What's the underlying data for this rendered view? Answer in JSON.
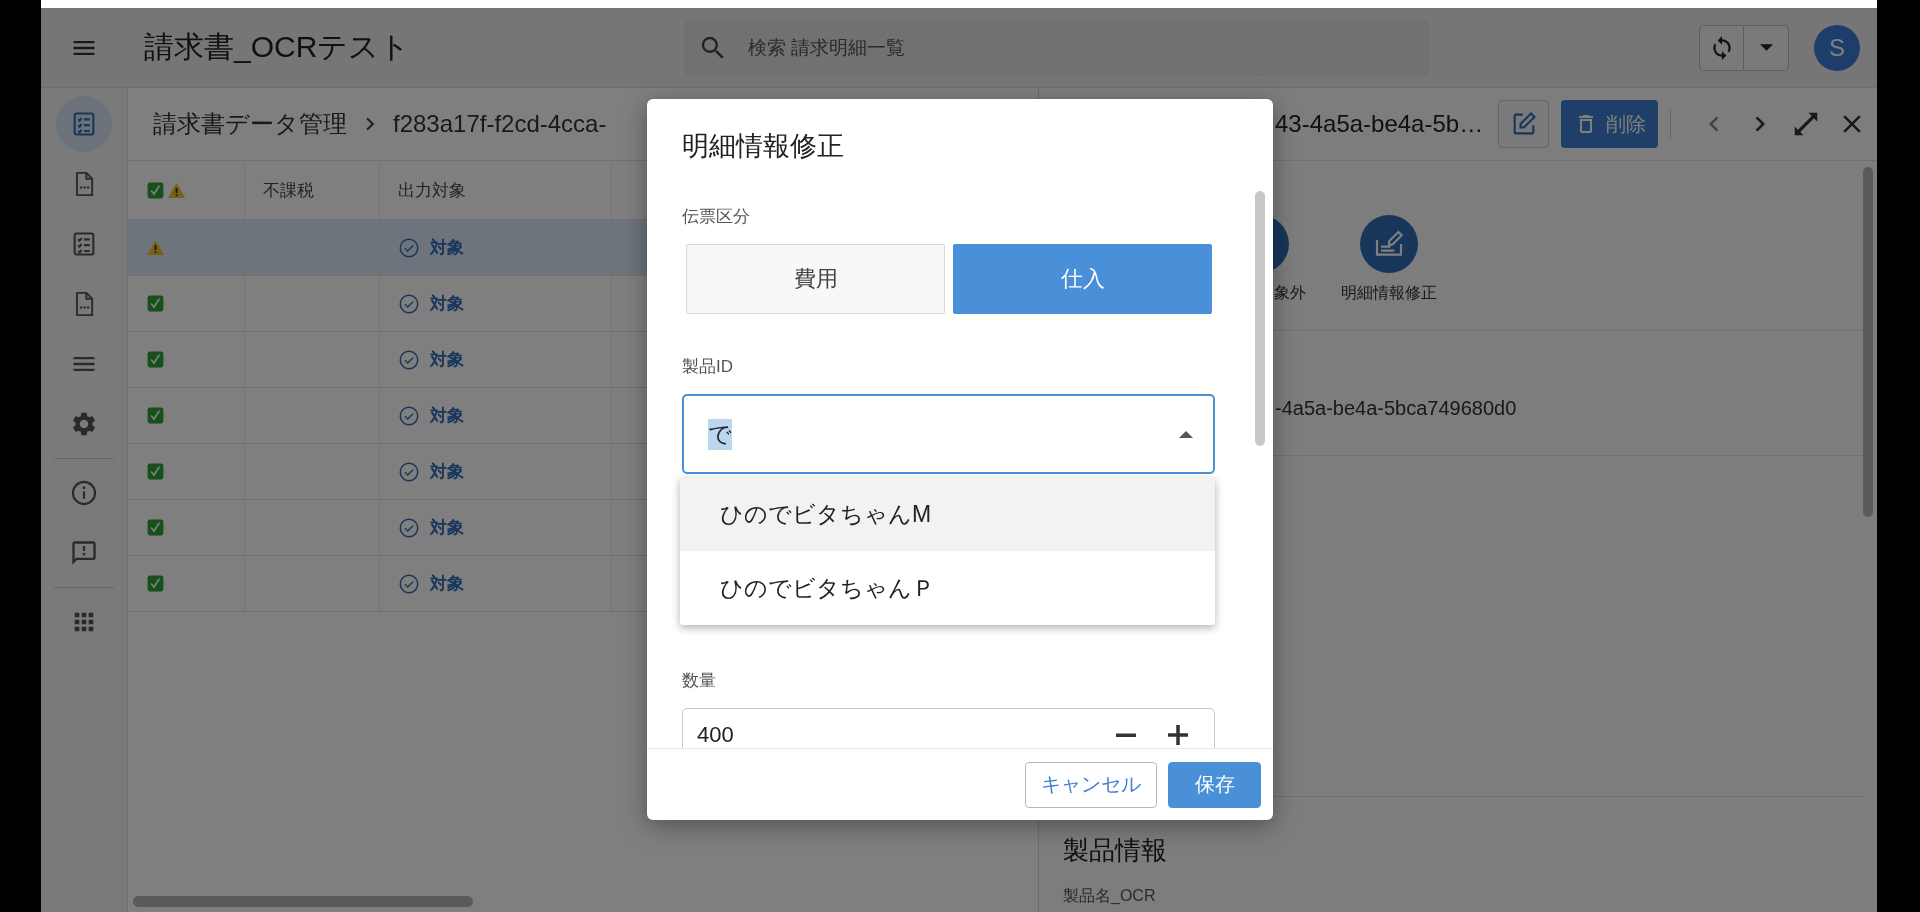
{
  "app_bar": {
    "title": "請求書_OCRテスト",
    "search": {
      "placeholder": "検索 請求明細一覧"
    },
    "avatar": "S"
  },
  "nav_rail": {
    "groups": [
      {
        "items": [
          {
            "kind": "checklist",
            "selected": true
          },
          {
            "kind": "csv",
            "selected": false
          },
          {
            "kind": "checklist",
            "selected": false
          },
          {
            "kind": "csv",
            "selected": false
          },
          {
            "kind": "list",
            "selected": false
          },
          {
            "kind": "settings",
            "selected": false
          }
        ]
      },
      {
        "items": [
          {
            "kind": "info",
            "selected": false
          },
          {
            "kind": "feedback",
            "selected": false
          }
        ]
      },
      {
        "items": [
          {
            "kind": "apps",
            "selected": false
          }
        ]
      }
    ]
  },
  "list_pane": {
    "breadcrumb": [
      "請求書データ管理",
      "f283a17f-f2cd-4cca-"
    ],
    "table": {
      "columns": [
        {
          "kind": "status"
        },
        {
          "kind": "text",
          "label": "不課税"
        },
        {
          "kind": "text",
          "label": "出力対象"
        }
      ],
      "rows": [
        {
          "kind": "warning",
          "target": "対象",
          "selected": true
        },
        {
          "kind": "ok",
          "target": "対象",
          "selected": false
        },
        {
          "kind": "ok",
          "target": "対象",
          "selected": false
        },
        {
          "kind": "ok",
          "target": "対象",
          "selected": false
        },
        {
          "kind": "ok",
          "target": "対象",
          "selected": false
        },
        {
          "kind": "ok",
          "target": "対象",
          "selected": false
        },
        {
          "kind": "ok",
          "target": "対象",
          "selected": false
        }
      ]
    }
  },
  "detail_pane": {
    "title": "43-4a5a-be4a-5b…",
    "delete_button": "削除",
    "actions": [
      {
        "kind": "plain",
        "label": "象外"
      },
      {
        "kind": "edit",
        "label": "明細情報修正"
      }
    ],
    "id_value": "-4a5a-be4a-5bca749680d0",
    "section_title": "製品情報",
    "field_label": "製品名_OCR"
  },
  "dialog": {
    "title": "明細情報修正",
    "voucher_type": {
      "label": "伝票区分",
      "options": [
        {
          "label": "費用",
          "selected": false
        },
        {
          "label": "仕入",
          "selected": true
        }
      ]
    },
    "product_id": {
      "label": "製品ID",
      "value": "で",
      "text_selected": true,
      "expanded": true,
      "options": [
        {
          "label": "ひのでビタちゃんM",
          "highlighted": true
        },
        {
          "label": "ひのでビタちゃんＰ",
          "highlighted": false
        }
      ]
    },
    "quantity": {
      "label": "数量",
      "value": "400"
    },
    "buttons": [
      {
        "kind": "secondary",
        "label": "キャンセル"
      },
      {
        "kind": "primary",
        "label": "保存"
      }
    ]
  }
}
